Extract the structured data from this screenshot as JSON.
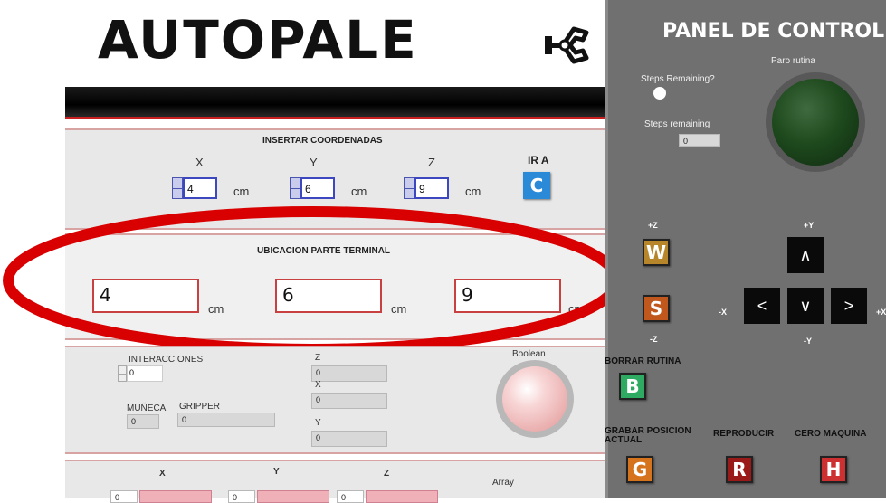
{
  "app": {
    "title": "AUTOPALE",
    "logo_icon": "robot-gripper-icon"
  },
  "coords": {
    "title": "INSERTAR COORDENADAS",
    "x_label": "X",
    "y_label": "Y",
    "z_label": "Z",
    "x_value": "4",
    "y_value": "6",
    "z_value": "9",
    "unit": "cm",
    "go_label": "IR A",
    "go_button": "C"
  },
  "terminal": {
    "title": "UBICACION PARTE TERMINAL",
    "x": "4",
    "y": "6",
    "z": "9",
    "unit": "cm"
  },
  "status": {
    "interacciones_label": "INTERACCIONES",
    "interacciones_value": "0",
    "muneca_label": "MUÑECA",
    "muneca_value": "0",
    "gripper_label": "GRIPPER",
    "gripper_value": "0",
    "z_label": "Z",
    "z_value": "0",
    "x_label": "X",
    "x_value": "0",
    "y_label": "Y",
    "y_value": "0",
    "boolean_label": "Boolean"
  },
  "bottom": {
    "x_label": "X",
    "y_label": "Y",
    "z_label": "Z",
    "x_value": "0",
    "y_value": "0",
    "z_value": "0",
    "array_label": "Array"
  },
  "control_panel": {
    "title": "PANEL DE CONTROL",
    "paro_label": "Paro rutina",
    "steps_remaining_q": "Steps Remaining?",
    "steps_remaining_label": "Steps remaining",
    "steps_remaining_value": "0",
    "plus_z": "+Z",
    "minus_z": "-Z",
    "plus_y": "+Y",
    "minus_y": "-Y",
    "plus_x": "+X",
    "minus_x": "-X",
    "w_button": "W",
    "s_button": "S",
    "borrar_label": "BORRAR RUTINA",
    "b_button": "B",
    "grabar_label": "GRABAR POSICION ACTUAL",
    "g_button": "G",
    "reproducir_label": "REPRODUCIR",
    "r_button": "R",
    "cero_label": "CERO MAQUINA",
    "h_button": "H",
    "up_arrow": "∧",
    "down_arrow": "∨",
    "left_arrow": "<",
    "right_arrow": ">"
  },
  "colors": {
    "accent_red": "#d80000",
    "w_color": "#b8862a",
    "s_color": "#c0581e",
    "b_color": "#2eaa62",
    "g_color": "#d6741e",
    "r_color": "#9a1a1a",
    "h_color": "#cc3030",
    "c_color": "#2a8ad8"
  }
}
